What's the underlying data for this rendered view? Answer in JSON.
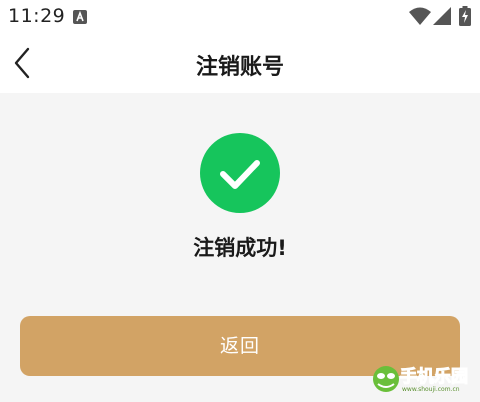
{
  "status_bar": {
    "time": "11:29",
    "icons": [
      "app-notification-icon",
      "wifi-icon",
      "signal-icon",
      "battery-charging-icon"
    ]
  },
  "header": {
    "back_icon": "chevron-left-icon",
    "title": "注销账号"
  },
  "result": {
    "icon": "checkmark-icon",
    "icon_color": "#16c55c",
    "message": "注销成功!"
  },
  "actions": {
    "return_label": "返回",
    "return_color": "#d2a365"
  },
  "watermark": {
    "text": "手机乐园",
    "subtext": "www.shouji.com.cn"
  }
}
